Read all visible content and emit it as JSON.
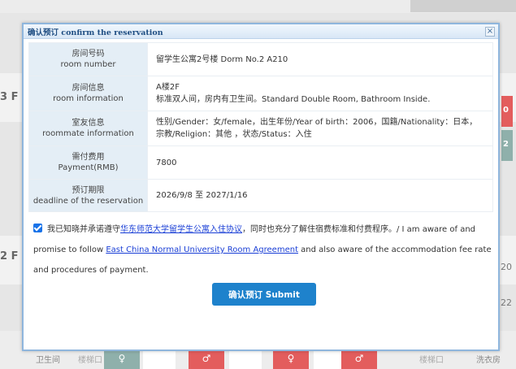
{
  "background": {
    "floors": [
      "3 F",
      "2 F"
    ],
    "side_cells": [
      "0",
      "2"
    ],
    "side_texts": [
      "20",
      "22"
    ],
    "bottom_labels": [
      "卫生间",
      "楼梯口",
      "楼梯口",
      "洗衣房"
    ],
    "bottom_dash": "-",
    "female_icon": "♀",
    "male_icon": "♂",
    "colors": {
      "red": "#e35d5d",
      "teal": "#8fb0ab"
    }
  },
  "modal": {
    "title": "确认预订 confirm the reservation",
    "close": "×",
    "rows": [
      {
        "label_cn": "房间号码",
        "label_en": "room number",
        "value": "留学生公寓2号楼 Dorm No.2 A210"
      },
      {
        "label_cn": "房间信息",
        "label_en": "room information",
        "value_line1": "A楼2F",
        "value_line2": "标准双人间，房内有卫生间。Standard Double Room, Bathroom Inside."
      },
      {
        "label_cn": "室友信息",
        "label_en": "roommate information",
        "value": "性别/Gender：女/female，出生年份/Year of birth：2006，国籍/Nationality：日本，宗教/Religion：其他 ，状态/Status：入住"
      },
      {
        "label_cn": "需付费用",
        "label_en": "Payment(RMB)",
        "value": "7800"
      },
      {
        "label_cn": "预订期限",
        "label_en": "deadline of the reservation",
        "value": "2026/9/8 至 2027/1/16"
      }
    ],
    "agreement": {
      "text_before": "我已知晓并承诺遵守",
      "link_cn": "华东师范大学留学生公寓入住协议",
      "text_mid": "，同时也充分了解住宿费标准和付费程序。/ I am aware of and promise to follow ",
      "link_en": "East China Normal University Room Agreement",
      "text_after": " and also aware of the accommodation fee rate and procedures of payment."
    },
    "submit_label": "确认预订 Submit"
  }
}
